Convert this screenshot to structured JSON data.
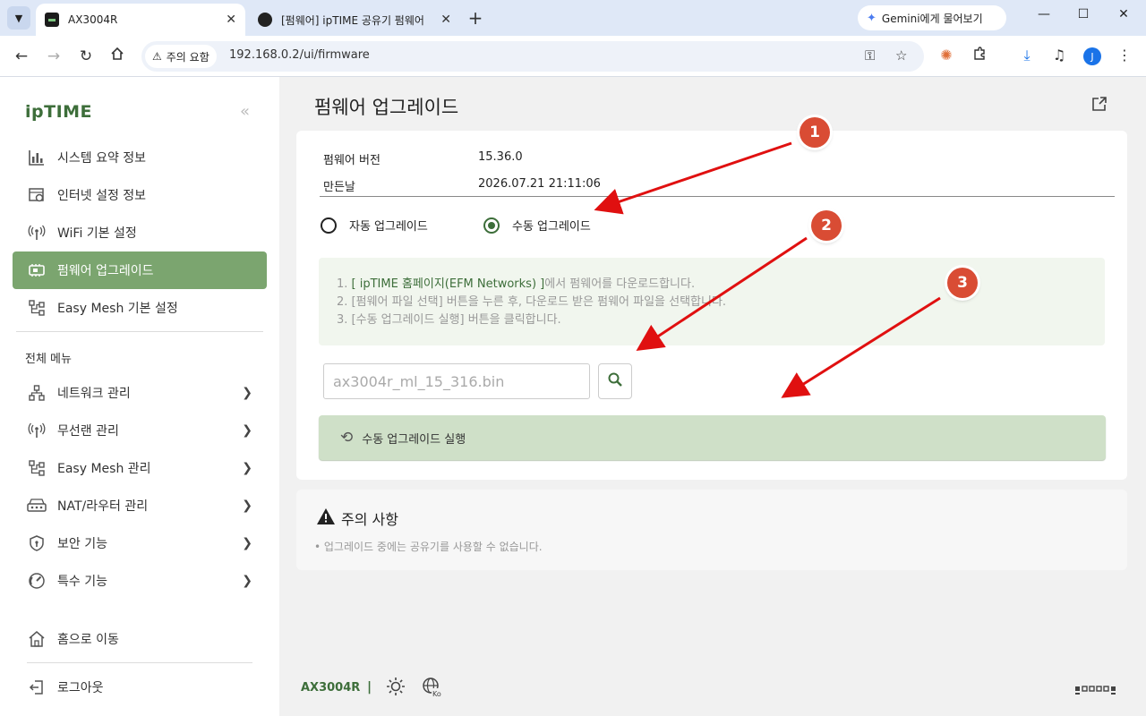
{
  "browser": {
    "tabs": [
      {
        "title": "AX3004R",
        "active": true
      },
      {
        "title": "[펌웨어] ipTIME 공유기 펌웨어",
        "active": false
      }
    ],
    "gemini_label": "Gemini에게 물어보기",
    "security_chip": "주의 요함",
    "url": "192.168.0.2/ui/firmware",
    "profile_initial": "J"
  },
  "sidebar": {
    "logo": "ipTIME",
    "top_items": [
      {
        "label": "시스템 요약 정보",
        "icon": "bar-chart-icon"
      },
      {
        "label": "인터넷 설정 정보",
        "icon": "globe-gear-icon"
      },
      {
        "label": "WiFi 기본 설정",
        "icon": "wifi-antenna-icon"
      },
      {
        "label": "펌웨어 업그레이드",
        "icon": "chip-icon",
        "active": true
      },
      {
        "label": "Easy Mesh 기본 설정",
        "icon": "mesh-icon"
      }
    ],
    "section_label": "전체 메뉴",
    "menu_items": [
      {
        "label": "네트워크 관리",
        "icon": "network-icon"
      },
      {
        "label": "무선랜 관리",
        "icon": "wireless-icon"
      },
      {
        "label": "Easy Mesh 관리",
        "icon": "mesh-icon"
      },
      {
        "label": "NAT/라우터 관리",
        "icon": "router-icon"
      },
      {
        "label": "보안 기능",
        "icon": "shield-icon"
      },
      {
        "label": "특수 기능",
        "icon": "gauge-icon"
      }
    ],
    "home_label": "홈으로 이동",
    "logout_label": "로그아웃"
  },
  "main": {
    "title": "펌웨어 업그레이드",
    "firmware_version_label": "펌웨어 버전",
    "firmware_version": "15.36.0",
    "build_date_label": "만든날",
    "build_date": "2026.07.21 21:11:06",
    "radio_auto": "자동 업그레이드",
    "radio_manual": "수동 업그레이드",
    "guide": {
      "line1_prefix": "1. ",
      "line1_link": "[ ipTIME 홈페이지(EFM Networks) ]",
      "line1_suffix": "에서 펌웨어를 다운로드합니다.",
      "line2": "2. [펌웨어 파일 선택] 버튼을 누른 후, 다운로드 받은 펌웨어 파일을 선택합니다.",
      "line3": "3. [수동 업그레이드 실행] 버튼을 클릭합니다."
    },
    "file_name": "ax3004r_ml_15_316.bin",
    "run_button": "수동 업그레이드 실행",
    "notice_title": "주의 사항",
    "notice_text": "• 업그레이드 중에는 공유기를 사용할 수 없습니다."
  },
  "footer": {
    "model": "AX3004R",
    "separator": "|",
    "lang_badge": "Ko"
  },
  "annotations": {
    "markers": [
      "1",
      "2",
      "3"
    ],
    "color": "#d94c34"
  },
  "colors": {
    "brand_green": "#3d6e3a",
    "active_menu": "#7ba56f",
    "run_button_bg": "#cfe0c8"
  }
}
